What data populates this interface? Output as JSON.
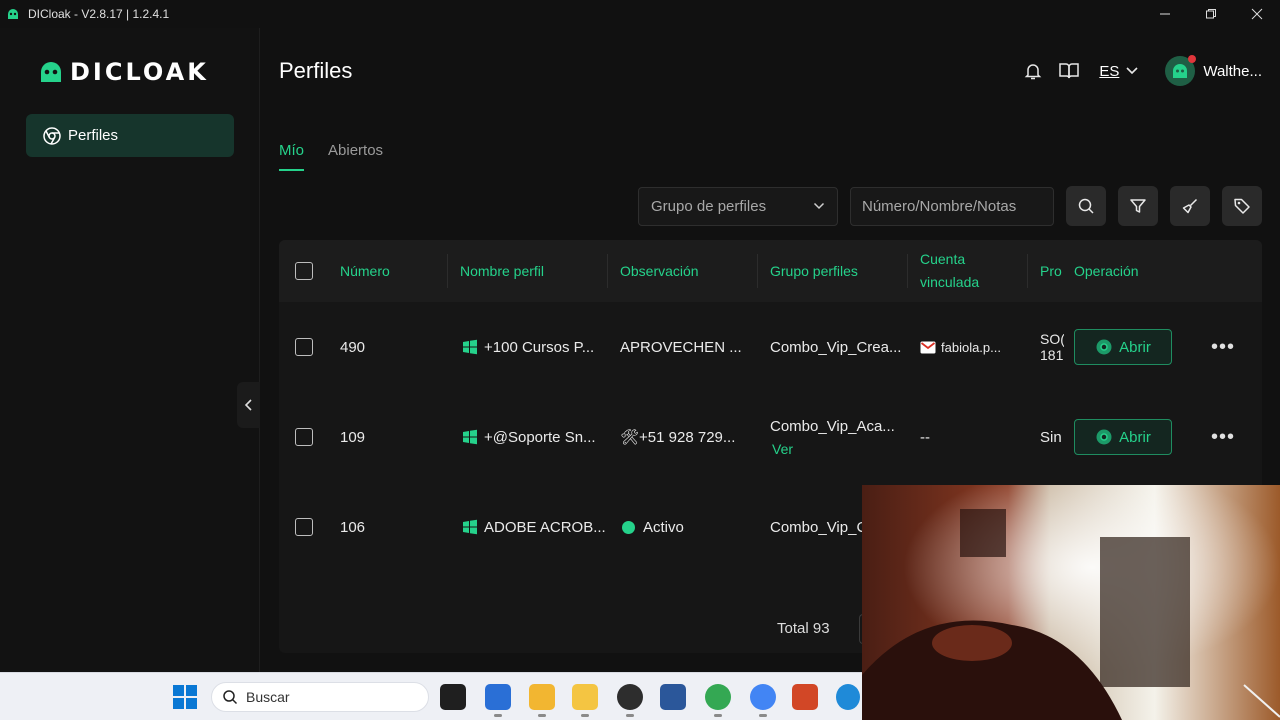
{
  "window": {
    "title": "DICloak - V2.8.17 | 1.2.4.1"
  },
  "sidebar": {
    "brand": "DICLOAK",
    "items": [
      {
        "label": "Perfiles"
      }
    ]
  },
  "header": {
    "title": "Perfiles",
    "language": "ES",
    "user_name": "Walthe..."
  },
  "tabs": [
    {
      "label": "Mío",
      "active": true
    },
    {
      "label": "Abiertos",
      "active": false
    }
  ],
  "toolbar": {
    "group_placeholder": "Grupo de perfiles",
    "search_placeholder": "Número/Nombre/Notas"
  },
  "table": {
    "columns": {
      "number": "Número",
      "name": "Nombre perfil",
      "observation": "Observación",
      "group": "Grupo perfiles",
      "account_line1": "Cuenta",
      "account_line2": "vinculada",
      "proxy": "Pro",
      "operation": "Operación"
    },
    "rows": [
      {
        "number": "490",
        "name": "+100 Cursos P...",
        "observation": "APROVECHEN ...",
        "group": "Combo_Vip_Crea...",
        "account": "fabiola.p...",
        "proxy_line1": "SO(",
        "proxy_line2": "181",
        "open_label": "Abrir"
      },
      {
        "number": "109",
        "name": "+@Soporte Sn...",
        "observation": "🛠+51 928 729...",
        "group": "Combo_Vip_Aca...",
        "group_link": "Ver",
        "account": "--",
        "proxy_line1": "Sin",
        "open_label": "Abrir"
      },
      {
        "number": "106",
        "name": "ADOBE ACROB...",
        "observation": "Activo",
        "group": "Combo_Vip_Cr"
      }
    ],
    "total": "Total 93"
  },
  "taskbar": {
    "search_label": "Buscar"
  },
  "colors": {
    "accent": "#25d28b",
    "background": "#111111",
    "row_active_nav": "#16352c"
  }
}
